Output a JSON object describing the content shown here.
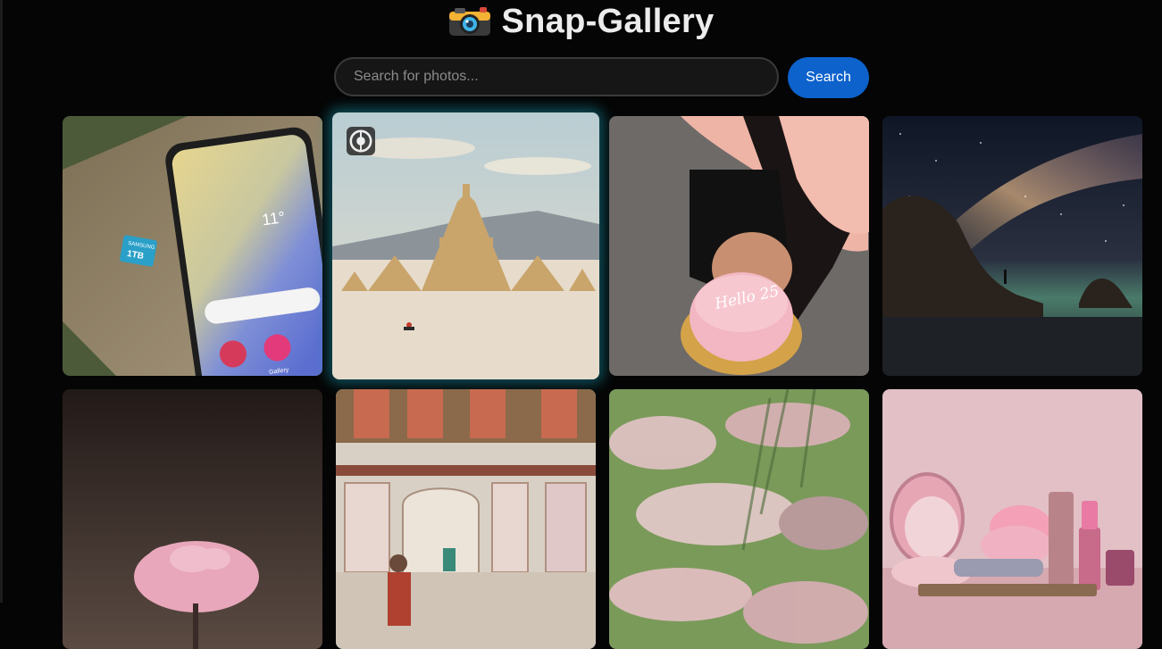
{
  "app": {
    "title": "Snap-Gallery",
    "logo_icon": "camera-icon"
  },
  "search": {
    "placeholder": "Search for photos...",
    "value": "",
    "button_label": "Search"
  },
  "colors": {
    "background": "#050505",
    "accent": "#0d62cc",
    "hover_glow": "#148ca0"
  },
  "gallery": {
    "items": [
      {
        "subject": "smartphone-on-wood-with-memory-card",
        "icon": "image-icon"
      },
      {
        "subject": "desert-temple-with-cyclist",
        "icon": "image-icon",
        "hovered": true,
        "overlay_icon": "lens-icon"
      },
      {
        "subject": "person-holding-pink-birthday-cake",
        "icon": "image-icon"
      },
      {
        "subject": "milky-way-over-rocky-coast",
        "icon": "image-icon"
      },
      {
        "subject": "pink-blossom-tree-at-night",
        "icon": "image-icon"
      },
      {
        "subject": "ornate-painted-interior",
        "icon": "image-icon"
      },
      {
        "subject": "blurred-pink-flowers",
        "icon": "image-icon"
      },
      {
        "subject": "pink-cosmetics-arrangement",
        "icon": "image-icon"
      }
    ],
    "cake_text": "Hello 25"
  },
  "phone": {
    "time": "11°",
    "memory_card": "1TB",
    "memory_brand": "SAMSUNG",
    "app_label": "Gallery"
  }
}
